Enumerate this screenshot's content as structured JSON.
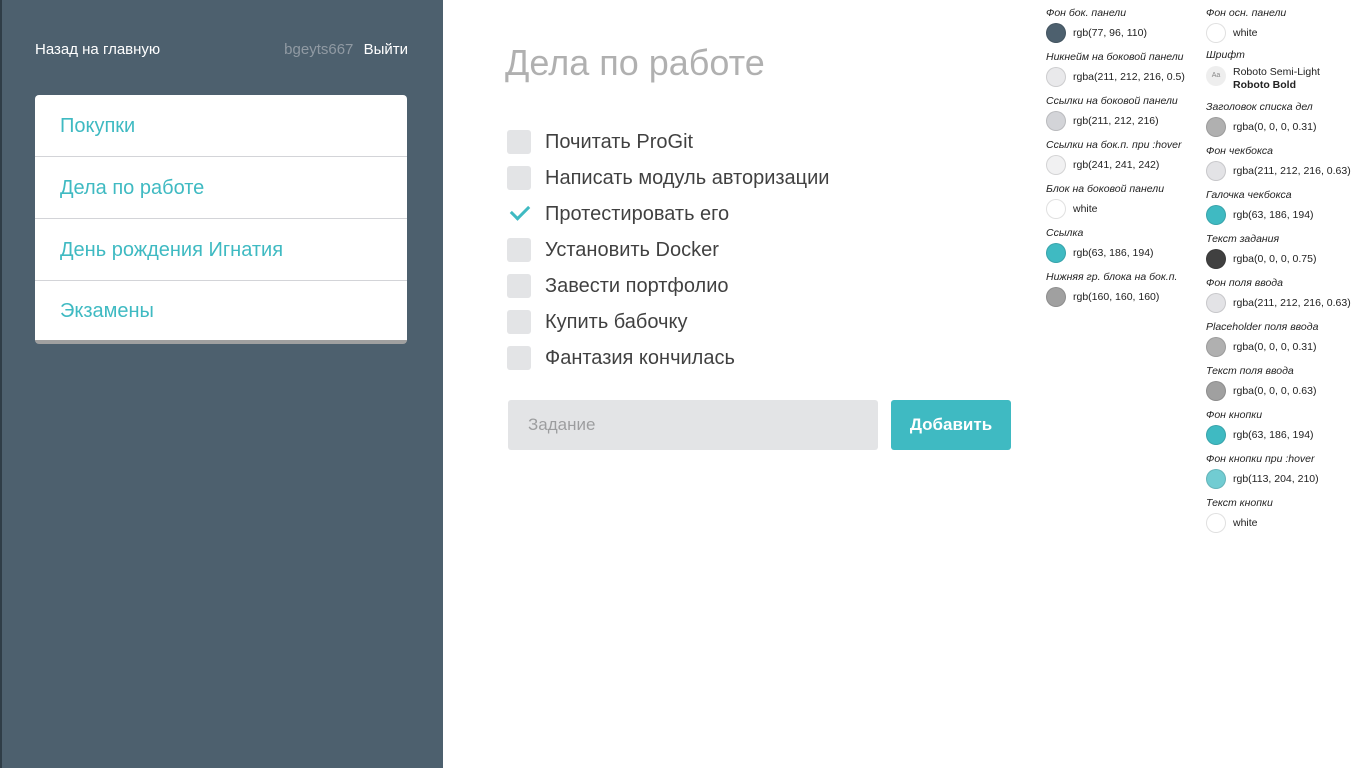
{
  "sidebar": {
    "back_label": "Назад на главную",
    "nickname": "bgeyts667",
    "logout_label": "Выйти",
    "lists": [
      {
        "label": "Покупки"
      },
      {
        "label": "Дела по работе"
      },
      {
        "label": "День рождения Игнатия"
      },
      {
        "label": "Экзамены"
      }
    ]
  },
  "main": {
    "title": "Дела по работе",
    "tasks": [
      {
        "text": "Почитать ProGit",
        "done": false
      },
      {
        "text": "Написать модуль авторизации",
        "done": false
      },
      {
        "text": "Протестировать его",
        "done": true
      },
      {
        "text": "Установить Docker",
        "done": false
      },
      {
        "text": "Завести портфолио",
        "done": false
      },
      {
        "text": "Купить бабочку",
        "done": false
      },
      {
        "text": "Фантазия кончилась",
        "done": false
      }
    ],
    "input_placeholder": "Задание",
    "input_value": "",
    "add_label": "Добавить"
  },
  "style_guide": {
    "column_a": [
      {
        "label": "Фон бок. панели",
        "value": "rgb(77, 96, 110)",
        "color": "#4d606e"
      },
      {
        "label": "Никнейм на боковой панели",
        "value": "rgba(211, 212, 216, 0.5)",
        "color": "#e9e9eb"
      },
      {
        "label": "Ссылки на боковой панели",
        "value": "rgb(211, 212, 216)",
        "color": "#d3d4d8"
      },
      {
        "label": "Ссылки на бок.п. при :hover",
        "value": "rgb(241, 241, 242)",
        "color": "#f1f1f2"
      },
      {
        "label": "Блок на боковой панели",
        "value": "white",
        "color": "#ffffff"
      },
      {
        "label": "Ссылка",
        "value": "rgb(63, 186, 194)",
        "color": "#3fbac2"
      },
      {
        "label": "Нижняя гр. блока на бок.п.",
        "value": "rgb(160, 160, 160)",
        "color": "#a0a0a0"
      }
    ],
    "column_b_first": {
      "label": "Фон осн. панели",
      "value": "white",
      "color": "#ffffff"
    },
    "font": {
      "label": "Шрифт",
      "swatch_text": "Aa",
      "light": "Roboto Semi-Light",
      "bold": "Roboto Bold"
    },
    "column_b": [
      {
        "label": "Заголовок списка дел",
        "value": "rgba(0, 0, 0, 0.31)",
        "color": "#b0b0b0"
      },
      {
        "label": "Фон чекбокса",
        "value": "rgba(211, 212, 216, 0.63)",
        "color": "#e3e3e6"
      },
      {
        "label": "Галочка чекбокса",
        "value": "rgb(63, 186, 194)",
        "color": "#3fbac2"
      },
      {
        "label": "Текст задания",
        "value": "rgba(0, 0, 0, 0.75)",
        "color": "#404040"
      },
      {
        "label": "Фон поля ввода",
        "value": "rgba(211, 212, 216, 0.63)",
        "color": "#e3e3e6"
      },
      {
        "label": "Placeholder поля ввода",
        "value": "rgba(0, 0, 0, 0.31)",
        "color": "#b0b0b0"
      },
      {
        "label": "Текст поля ввода",
        "value": "rgba(0, 0, 0, 0.63)",
        "color": "#a0a0a0"
      },
      {
        "label": "Фон кнопки",
        "value": "rgb(63, 186, 194)",
        "color": "#3fbac2"
      },
      {
        "label": "Фон кнопки при :hover",
        "value": "rgb(113, 204, 210)",
        "color": "#71ccd2"
      },
      {
        "label": "Текст кнопки",
        "value": "white",
        "color": "#ffffff"
      }
    ]
  }
}
